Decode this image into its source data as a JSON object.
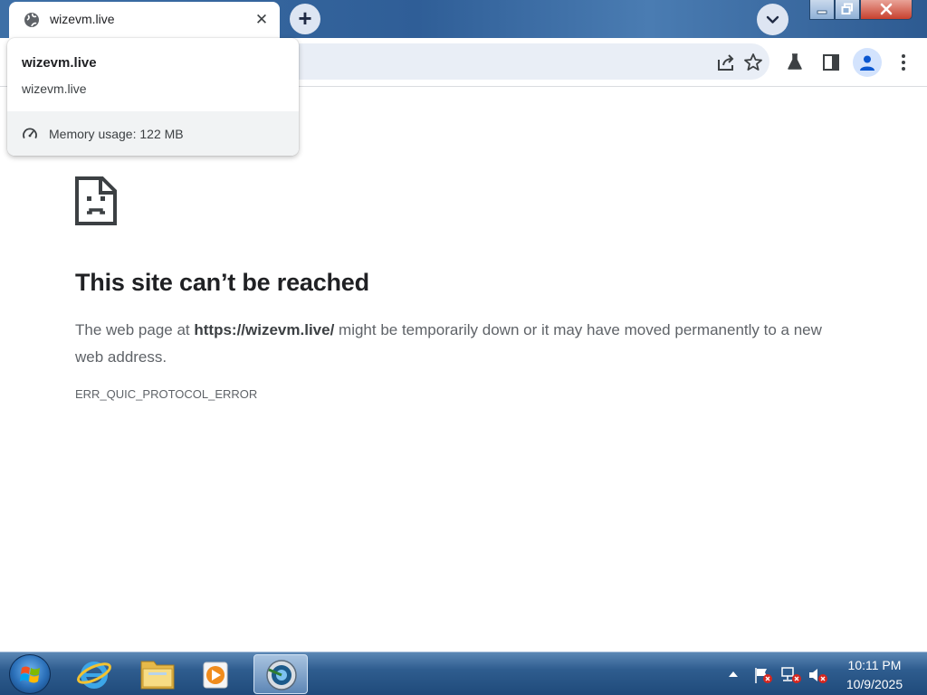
{
  "browser": {
    "tab": {
      "title": "wizevm.live",
      "close_glyph": "✕"
    },
    "new_tab_glyph": "+",
    "toolbar_icons": [
      "share-icon",
      "bookmark-star-icon",
      "labs-flask-icon",
      "side-panel-icon",
      "profile-icon",
      "menu-icon"
    ]
  },
  "hover_card": {
    "title": "wizevm.live",
    "domain": "wizevm.live",
    "memory": "Memory usage: 122 MB"
  },
  "error_page": {
    "heading": "This site can’t be reached",
    "desc_prefix": "The web page at ",
    "url": "https://wizevm.live/",
    "desc_suffix": " might be temporarily down or it may have moved permanently to a new web address.",
    "code": "ERR_QUIC_PROTOCOL_ERROR"
  },
  "taskbar": {
    "pinned": [
      "internet-explorer-icon",
      "file-explorer-icon",
      "media-player-icon",
      "chrome-icon"
    ],
    "tray_icons": [
      "show-hidden-icons-arrow",
      "action-center-flag-icon",
      "network-icon",
      "volume-muted-icon"
    ],
    "clock": {
      "time": "10:11 PM",
      "date": "10/9/2025"
    }
  },
  "colors": {
    "accent": "#1a73e8",
    "heading": "#202124",
    "body_text": "#5f6368",
    "taskbar": "#2f5d8f"
  }
}
